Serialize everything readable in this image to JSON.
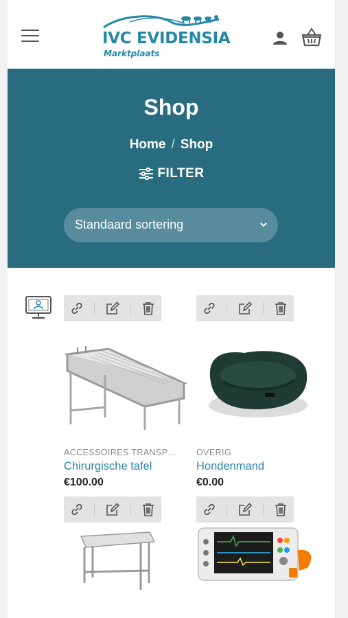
{
  "header": {
    "logo_title": "IVC EVIDENSIA",
    "logo_subtitle": "Marktplaats",
    "menu_icon": "hamburger-menu-icon",
    "account_icon": "user-icon",
    "cart_icon": "basket-icon"
  },
  "hero": {
    "title": "Shop",
    "breadcrumb": {
      "home": "Home",
      "separator": "/",
      "current": "Shop"
    },
    "filter_label": "FILTER",
    "sort": {
      "selected": "Standaard sortering"
    }
  },
  "colors": {
    "hero_bg": "#296c80",
    "link": "#2e86a8",
    "logo": "#2489a6"
  },
  "products": [
    {
      "category": "ACCESSOIRES TRANSPO...",
      "name": "Chirurgische tafel",
      "price": "€100.00"
    },
    {
      "category": "OVERIG",
      "name": "Hondenmand",
      "price": "€0.00"
    },
    {
      "category": "",
      "name": "",
      "price": ""
    },
    {
      "category": "",
      "name": "",
      "price": ""
    }
  ]
}
